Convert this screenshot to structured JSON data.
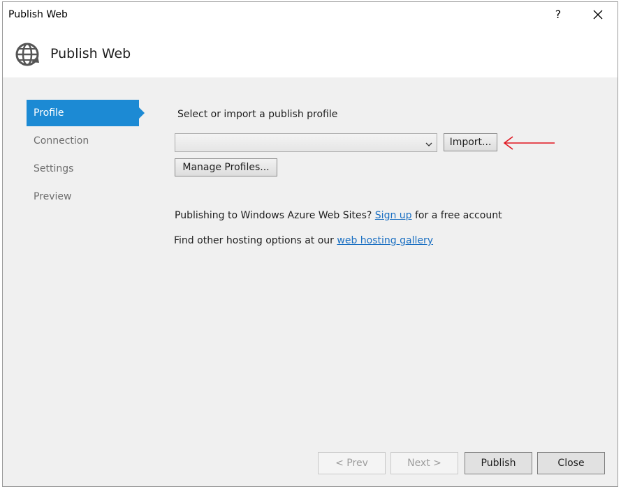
{
  "window": {
    "title": "Publish Web",
    "help_label": "?"
  },
  "header": {
    "title": "Publish Web",
    "icon": "globe-publish-icon"
  },
  "nav": {
    "items": [
      {
        "label": "Profile",
        "active": true
      },
      {
        "label": "Connection",
        "active": false
      },
      {
        "label": "Settings",
        "active": false
      },
      {
        "label": "Preview",
        "active": false
      }
    ]
  },
  "profile": {
    "prompt": "Select or import a publish profile",
    "selected_value": "",
    "import_label": "Import...",
    "manage_label": "Manage Profiles..."
  },
  "links": {
    "azure_prefix": "Publishing to Windows Azure Web Sites?",
    "azure_link": "Sign up",
    "azure_suffix": "for a free account",
    "gallery_prefix": "Find other hosting options at our",
    "gallery_link": "web hosting gallery"
  },
  "footer": {
    "prev_label": "< Prev",
    "next_label": "Next >",
    "publish_label": "Publish",
    "close_label": "Close"
  },
  "colors": {
    "accent": "#1c8ad4",
    "link": "#1a6fc2",
    "annotation_arrow": "#e0141e"
  }
}
